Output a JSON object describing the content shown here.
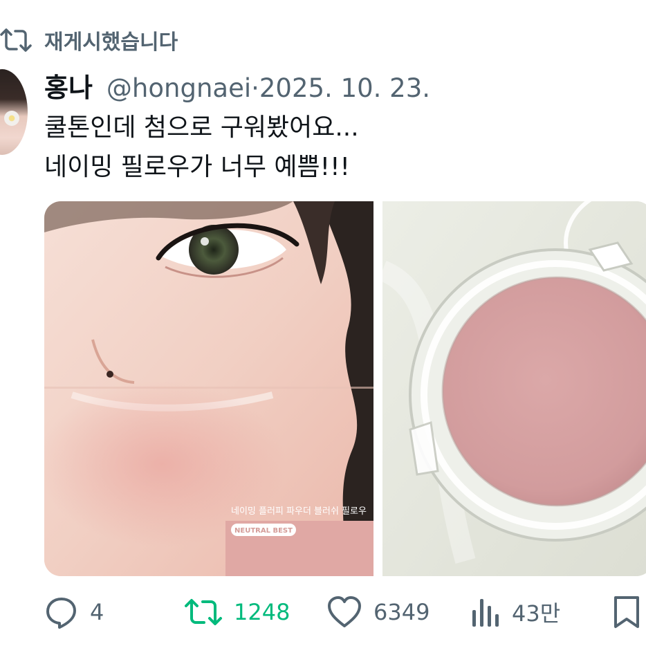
{
  "repost": {
    "label": "재게시했습니다",
    "icon": "repost-icon"
  },
  "tweet": {
    "author_name": "홍나",
    "author_handle": "@hongnaei",
    "date": "2025. 10. 23.",
    "text_line1": "쿨톤인데 첨으로 구워봤어요...",
    "text_line2": "네이밍 필로우가 너무 예쁨!!!"
  },
  "media": {
    "left_overlay_caption": "네이밍 플러피 파우더 블러쉬 필로우",
    "left_overlay_badge": "NEUTRAL BEST"
  },
  "actions": {
    "replies": "4",
    "reposts": "1248",
    "likes": "6349",
    "views": "43만"
  },
  "colors": {
    "text_primary": "#0f1419",
    "text_secondary": "#536471",
    "repost_active": "#00ba7c"
  }
}
